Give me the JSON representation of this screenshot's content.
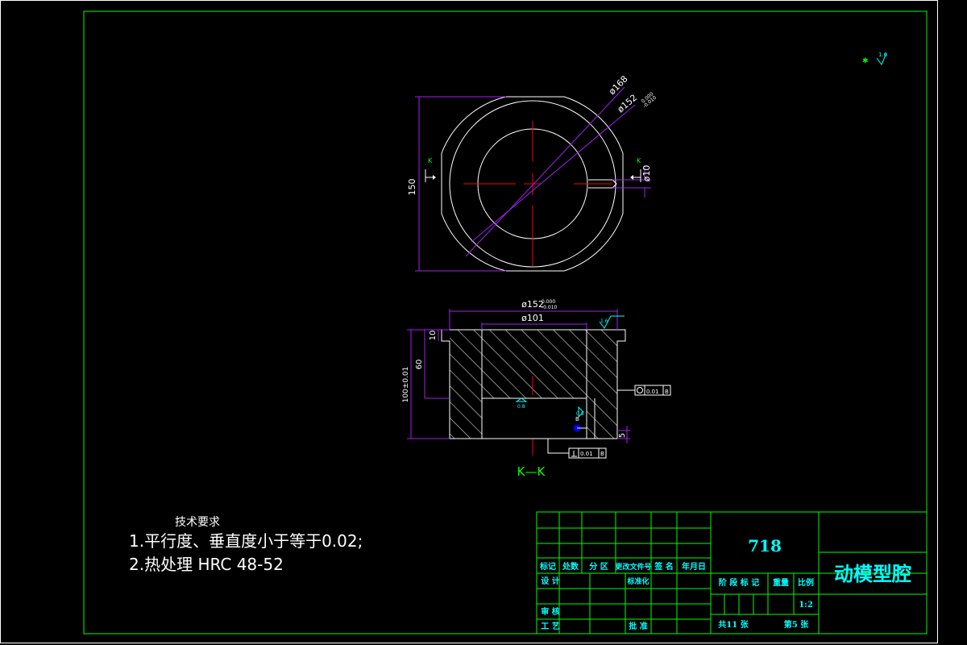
{
  "drawing": {
    "top_view": {
      "dim_outer": "ø168",
      "dim_bore": "ø152",
      "dim_bore_tol_upper": "0.000",
      "dim_bore_tol_lower": "-0.010",
      "dim_height": "150",
      "dim_hole": "ø10",
      "section_mark_left": "K",
      "section_mark_right": "K"
    },
    "section_view": {
      "dim_top": "ø152",
      "dim_top_tol_upper": "0.000",
      "dim_top_tol_lower": "-0.010",
      "dim_inner": "ø101",
      "dim_step": "10",
      "dim_depth": "60",
      "dim_total": "100±0.01",
      "dim_bottom": "5",
      "roughness_top": "1.6",
      "roughness_bottom": "0.8",
      "roughness_side": "0.8",
      "gdt_flat_value": "0.01",
      "gdt_flat_datum": "B",
      "gdt_perp_value": "0.01",
      "gdt_perp_datum": "B",
      "datum_label": "B",
      "section_label": "K—K"
    },
    "corner_roughness": "1.6",
    "tech_requirements": {
      "title": "技术要求",
      "item1": "1.平行度、垂直度小于等于0.02;",
      "item2": "2.热处理  HRC 48-52"
    }
  },
  "title_block": {
    "material": "718",
    "part_name": "动模型腔",
    "header_cells": [
      "标记",
      "处数",
      "分 区",
      "更改文件号",
      "签 名",
      "年月日"
    ],
    "row_design": "设 计",
    "row_standard": "标准化",
    "row_review": "审 核",
    "row_process": "工 艺",
    "row_approve": "批 准",
    "stage_label": "阶 段 标 记",
    "weight_label": "重量",
    "scale_label": "比例",
    "scale_value": "1:2",
    "total_sheets": "共11 张",
    "sheet_no": "第5 张"
  },
  "colors": {
    "frame": "#00ff00",
    "part_outline": "#ffffff",
    "centerline": "#ff0000",
    "dimension": "#a020f0",
    "text_cyan": "#00ffff",
    "text_white": "#ffffff"
  }
}
